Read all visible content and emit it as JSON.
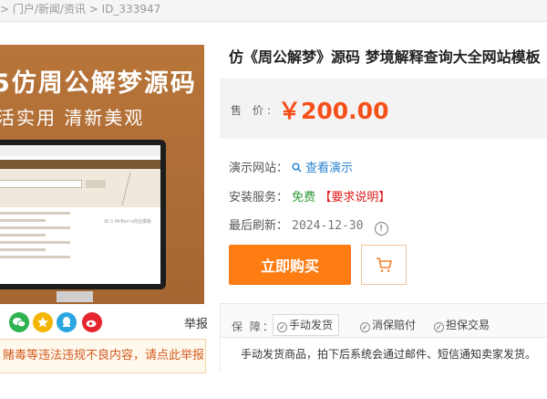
{
  "breadcrumb": {
    "text": "> 门户/新闻/资讯 > ID_333947"
  },
  "product_image": {
    "headline": "5仿周公解梦源码",
    "subline": "活实用  清新美观",
    "screen_banner_text": "ID:1 MrBen's商业模板"
  },
  "share": {
    "icons": [
      "wechat-icon",
      "star-icon",
      "qq-icon",
      "weibo-icon"
    ],
    "report_label": "举报"
  },
  "warning": {
    "text": "赌毒等违法违规不良内容，请点此举报！"
  },
  "product": {
    "title": "仿《周公解梦》源码 梦境解释查询大全网站模板 《",
    "price_label": "售 价:",
    "price": "￥200.00"
  },
  "details": {
    "demo_label": "演示网站：",
    "demo_link": "查看演示",
    "service_label": "安装服务：",
    "service_value": "免费",
    "service_note": "【要求说明】",
    "refresh_label": "最后刷新：",
    "refresh_date": "2024-12-30"
  },
  "actions": {
    "buy_label": "立即购买"
  },
  "guarantee": {
    "label": "保  障：",
    "tags": [
      "手动发货",
      "消保赔付",
      "担保交易"
    ],
    "description": "手动发货商品，拍下后系统会通过邮件、短信通知卖家发货。"
  },
  "colors": {
    "accent": "#ff7c13",
    "price": "#f6501a",
    "link": "#2b83d0",
    "free": "#2e9a32",
    "warning": "#d35b1f"
  }
}
